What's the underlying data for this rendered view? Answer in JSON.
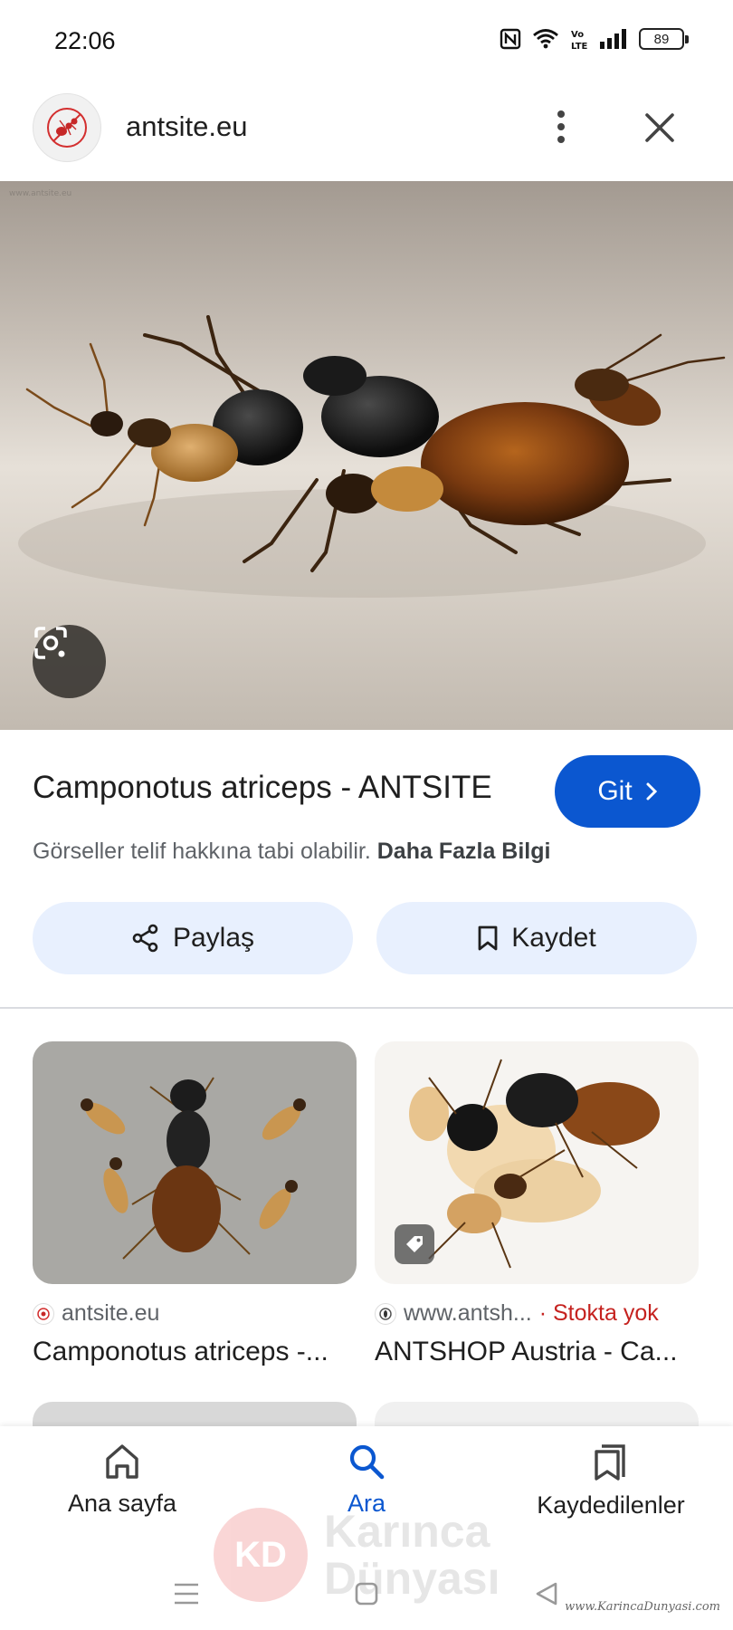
{
  "status_bar": {
    "time": "22:06",
    "battery": "89",
    "icons": [
      "nfc-icon",
      "wifi-icon",
      "volte-icon",
      "signal-icon",
      "battery-icon"
    ]
  },
  "header": {
    "site_name": "antsite.eu",
    "more_icon": "more-vert-icon",
    "close_icon": "close-icon"
  },
  "result": {
    "title": "Camponotus atriceps - ANTSITE",
    "go_label": "Git",
    "copyright_text": "Görseller telif hakkına tabi olabilir.",
    "more_info": "Daha Fazla Bilgi"
  },
  "actions": {
    "share_label": "Paylaş",
    "save_label": "Kaydet"
  },
  "related": [
    {
      "source": "antsite.eu",
      "title": "Camponotus atriceps -...",
      "stock": ""
    },
    {
      "source": "www.antsh...",
      "stock": "· Stokta yok",
      "title": "ANTSHOP Austria - Ca..."
    }
  ],
  "bottom_nav": {
    "home": "Ana sayfa",
    "search": "Ara",
    "saved": "Kaydedilenler"
  },
  "watermark": {
    "logo": "KD",
    "line1": "Karınca",
    "line2": "Dünyası",
    "url": "www.KarincaDunyasi.com"
  },
  "colors": {
    "accent": "#0b57d0",
    "chip_bg": "#e8f0fe",
    "out_of_stock": "#c5221f"
  }
}
